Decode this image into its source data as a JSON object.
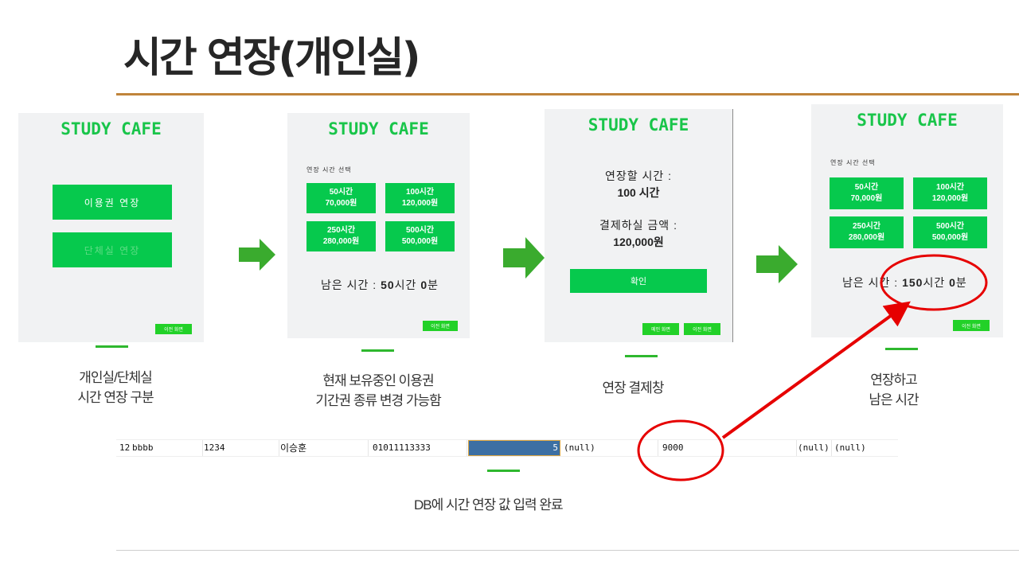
{
  "slide": {
    "title": "시간 연장(개인실)"
  },
  "screen1": {
    "logo": "STUDY CAFE",
    "btn_pass": "이용권 연장",
    "btn_group": "단체실 연장",
    "btn_prev": "이전 화면",
    "caption_line1": "개인실/단체실",
    "caption_line2": "시간 연장 구분"
  },
  "screen2": {
    "logo": "STUDY CAFE",
    "select_label": "연장 시간 선택",
    "options": [
      {
        "hours": "50시간",
        "price": "70,000원"
      },
      {
        "hours": "100시간",
        "price": "120,000원"
      },
      {
        "hours": "250시간",
        "price": "280,000원"
      },
      {
        "hours": "500시간",
        "price": "500,000원"
      }
    ],
    "remain_prefix": "남은 시간 : ",
    "remain_hours": "50",
    "remain_hours_unit": "시간 ",
    "remain_minutes": "0",
    "remain_minutes_unit": "분",
    "btn_prev": "이전 화면",
    "caption_line1": "현재 보유중인 이용권",
    "caption_line2": "기간권 종류 변경 가능함"
  },
  "screen3": {
    "logo": "STUDY CAFE",
    "extend_label": "연장할 시간 :",
    "extend_value": "100 시간",
    "pay_label": "결제하실 금액 :",
    "pay_value": "120,000원",
    "btn_confirm": "확인",
    "btn_home": "메인 화면",
    "btn_prev": "이전 화면",
    "caption": "연장 결제창"
  },
  "screen4": {
    "logo": "STUDY CAFE",
    "select_label": "연장 시간 선택",
    "options": [
      {
        "hours": "50시간",
        "price": "70,000원"
      },
      {
        "hours": "100시간",
        "price": "120,000원"
      },
      {
        "hours": "250시간",
        "price": "280,000원"
      },
      {
        "hours": "500시간",
        "price": "500,000원"
      }
    ],
    "remain_prefix": "남은 시간 : ",
    "remain_hours": "150",
    "remain_hours_unit": "시간 ",
    "remain_minutes": "0",
    "remain_minutes_unit": "분",
    "btn_prev": "이전 화면",
    "caption_line1": "연장하고",
    "caption_line2": "남은 시간"
  },
  "db": {
    "cells": [
      "12",
      "bbbb",
      "1234",
      "이승훈",
      "01011113333",
      "5",
      "(null)",
      "9000",
      "(null)",
      "(null)"
    ],
    "caption": "DB에 시간 연장 값 입력 완료"
  },
  "colors": {
    "accent_green": "#06c94d",
    "logo_green": "#19c54a",
    "arrow_green": "#3aab2e",
    "highlight_red": "#e60000",
    "rule": "#c0843a"
  }
}
